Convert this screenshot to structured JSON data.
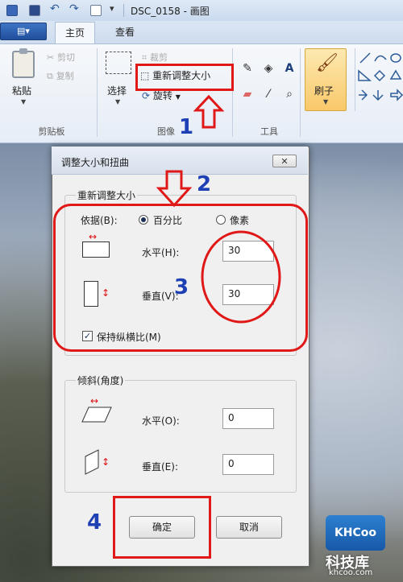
{
  "titlebar": {
    "window_title": "DSC_0158 - 画图",
    "qa_dropdown": "▾"
  },
  "tabs": {
    "file_menu": "▤▾",
    "home": "主页",
    "view": "查看"
  },
  "ribbon": {
    "clipboard": {
      "paste": "粘贴",
      "cut": "剪切",
      "copy": "复制",
      "group": "剪贴板"
    },
    "image": {
      "select": "选择",
      "crop": "裁剪",
      "resize": "重新调整大小",
      "rotate": "旋转",
      "group": "图像"
    },
    "tools": {
      "group": "工具"
    },
    "brush": {
      "label": "刷子"
    },
    "dropdown_arrow": "▼"
  },
  "annotations": {
    "n1": "1",
    "n2": "2",
    "n3": "3",
    "n4": "4"
  },
  "dialog": {
    "title": "调整大小和扭曲",
    "close": "✕",
    "resize": {
      "title": "重新调整大小",
      "by_label": "依据(B):",
      "percent_label": "百分比",
      "pixels_label": "像素",
      "selected_mode": "percent",
      "horizontal_label": "水平(H):",
      "horizontal_value": "30",
      "vertical_label": "垂直(V):",
      "vertical_value": "30",
      "keep_ratio_label": "保持纵横比(M)",
      "keep_ratio_checked": true
    },
    "skew": {
      "title": "倾斜(角度)",
      "horizontal_label": "水平(O):",
      "horizontal_value": "0",
      "vertical_label": "垂直(E):",
      "vertical_value": "0"
    },
    "ok": "确定",
    "cancel": "取消"
  },
  "watermark": {
    "logo": "KHCoo",
    "name": "科技库",
    "url": "khcoo.com"
  },
  "colors": {
    "annotation_red": "#e01818",
    "annotation_blue": "#1f3fb5",
    "brush_active": "#f9c86a"
  }
}
